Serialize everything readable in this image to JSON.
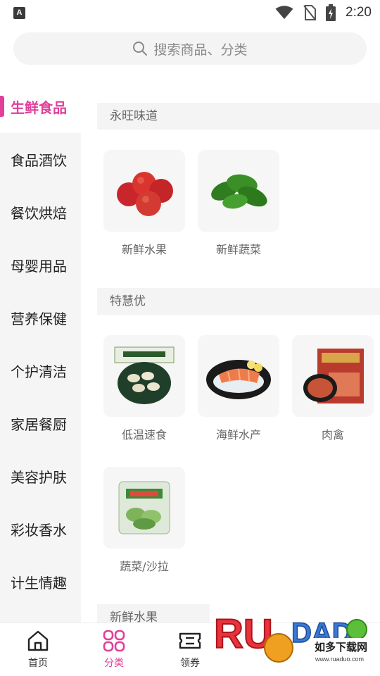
{
  "status_bar": {
    "left_icon": "A",
    "time": "2:20",
    "icons": [
      "wifi-icon",
      "no-sim-icon",
      "battery-charging-icon"
    ]
  },
  "search": {
    "placeholder": "搜索商品、分类"
  },
  "sidebar": {
    "items": [
      {
        "label": "生鲜食品",
        "active": true
      },
      {
        "label": "食品酒饮",
        "active": false
      },
      {
        "label": "餐饮烘焙",
        "active": false
      },
      {
        "label": "母婴用品",
        "active": false
      },
      {
        "label": "营养保健",
        "active": false
      },
      {
        "label": "个护清洁",
        "active": false
      },
      {
        "label": "家居餐厨",
        "active": false
      },
      {
        "label": "美容护肤",
        "active": false
      },
      {
        "label": "彩妆香水",
        "active": false
      },
      {
        "label": "计生情趣",
        "active": false
      }
    ]
  },
  "sections": [
    {
      "title": "永旺味道",
      "items": [
        {
          "label": "新鲜水果",
          "icon": "apples-image"
        },
        {
          "label": "新鲜蔬菜",
          "icon": "spinach-image"
        }
      ]
    },
    {
      "title": "特慧优",
      "items": [
        {
          "label": "低温速食",
          "icon": "dumplings-image"
        },
        {
          "label": "海鲜水产",
          "icon": "salmon-image"
        },
        {
          "label": "肉禽",
          "icon": "packaged-meat-image"
        },
        {
          "label": "蔬菜/沙拉",
          "icon": "salad-box-image"
        }
      ]
    },
    {
      "title": "新鲜水果",
      "items": []
    }
  ],
  "bottom_nav": {
    "items": [
      {
        "label": "首页",
        "icon": "home-icon",
        "active": false
      },
      {
        "label": "分类",
        "icon": "category-icon",
        "active": true
      },
      {
        "label": "领券",
        "icon": "coupon-icon",
        "active": false
      }
    ]
  },
  "watermark": {
    "brand": "RUANDAO",
    "tagline": "如多下载网",
    "url": "www.ruaduo.com"
  },
  "colors": {
    "accent": "#e0409a",
    "sidebar_bg": "#f5f5f5",
    "tile_bg": "#f6f6f6",
    "section_bg": "#f4f4f4"
  }
}
